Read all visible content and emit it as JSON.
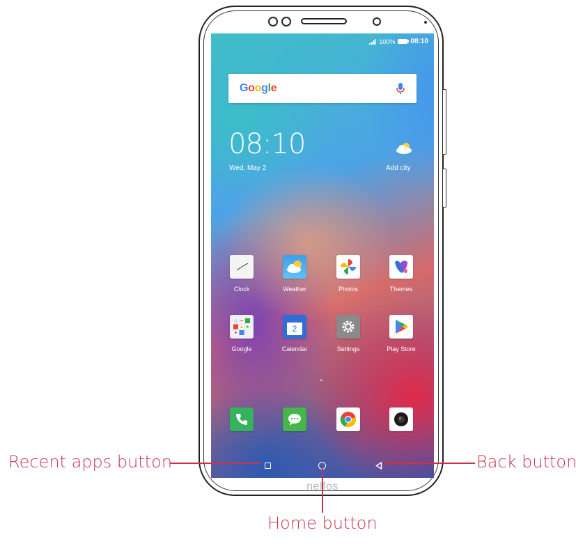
{
  "status_bar": {
    "signal_text": "ıl",
    "battery_percent": "100%",
    "time": "08:10"
  },
  "search_widget": {
    "brand_letters": [
      "G",
      "o",
      "o",
      "g",
      "l",
      "e"
    ],
    "brand_colors": [
      "#4285F4",
      "#EA4335",
      "#FBBC05",
      "#4285F4",
      "#34A853",
      "#EA4335"
    ]
  },
  "clock_widget": {
    "time": "08:10",
    "date": "Wed, May 2",
    "weather_label": "Add city"
  },
  "apps_row1": [
    {
      "label": "Clock",
      "icon": "clock-icon"
    },
    {
      "label": "Weather",
      "icon": "weather-icon"
    },
    {
      "label": "Photos",
      "icon": "photos-icon"
    },
    {
      "label": "Themes",
      "icon": "themes-icon"
    }
  ],
  "apps_row2": [
    {
      "label": "Google",
      "icon": "google-folder-icon"
    },
    {
      "label": "Calendar",
      "icon": "calendar-icon",
      "day": "2"
    },
    {
      "label": "Settings",
      "icon": "settings-icon"
    },
    {
      "label": "Play Store",
      "icon": "play-store-icon"
    }
  ],
  "dock": [
    "phone-icon",
    "messages-icon",
    "chrome-icon",
    "camera-icon"
  ],
  "brand": "nelfos",
  "callouts": {
    "recent": "Recent apps button",
    "back": "Back button",
    "home": "Home button"
  },
  "accent_color": "#c8344d"
}
